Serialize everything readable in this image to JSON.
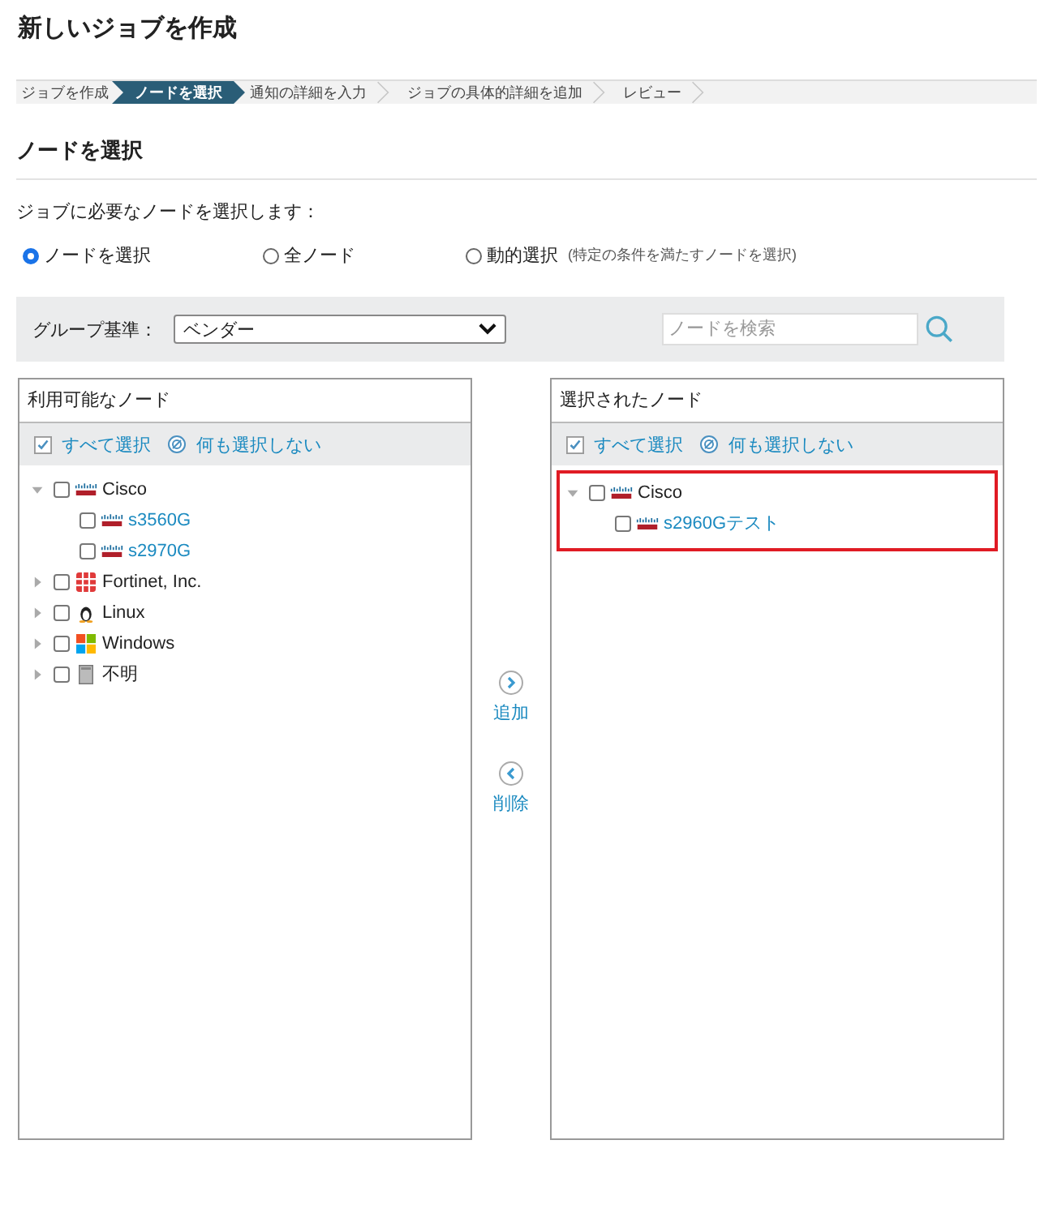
{
  "title": "新しいジョブを作成",
  "steps": [
    {
      "label": "ジョブを作成",
      "selected": false
    },
    {
      "label": "ノードを選択",
      "selected": true
    },
    {
      "label": "通知の詳細を入力",
      "selected": false
    },
    {
      "label": "ジョブの具体的詳細を追加",
      "selected": false
    },
    {
      "label": "レビュー",
      "selected": false
    }
  ],
  "section_title": "ノードを選択",
  "instruction": "ジョブに必要なノードを選択します：",
  "modes": [
    {
      "label": "ノードを選択",
      "selected": true
    },
    {
      "label": "全ノード",
      "selected": false
    },
    {
      "label": "動的選択",
      "note": "(特定の条件を満たすノードを選択)",
      "selected": false
    }
  ],
  "group_by": {
    "label": "グループ基準：",
    "value": "ベンダー"
  },
  "search": {
    "placeholder": "ノードを検索"
  },
  "available": {
    "title": "利用可能なノード",
    "select_all": "すべて選択",
    "select_none": "何も選択しない",
    "tree": [
      {
        "label": "Cisco",
        "kind": "cisco",
        "expanded": true,
        "checked": false,
        "children": [
          {
            "label": "s3560G",
            "kind": "cisco",
            "checked": false
          },
          {
            "label": "s2970G",
            "kind": "cisco",
            "checked": false
          }
        ]
      },
      {
        "label": "Fortinet, Inc.",
        "kind": "fortinet",
        "expanded": false,
        "checked": false
      },
      {
        "label": "Linux",
        "kind": "linux",
        "expanded": false,
        "checked": false
      },
      {
        "label": "Windows",
        "kind": "windows",
        "expanded": false,
        "checked": false
      },
      {
        "label": "不明",
        "kind": "unknown",
        "expanded": false,
        "checked": false
      }
    ]
  },
  "actions": [
    {
      "label": "追加",
      "kind": "add"
    },
    {
      "label": "削除",
      "kind": "remove"
    }
  ],
  "selected": {
    "title": "選択されたノード",
    "select_all": "すべて選択",
    "select_none": "何も選択しない",
    "highlighted": true,
    "tree": [
      {
        "label": "Cisco",
        "kind": "cisco",
        "expanded": true,
        "checked": false,
        "children": [
          {
            "label": "s2960Gテスト",
            "kind": "cisco",
            "checked": false
          }
        ]
      }
    ]
  }
}
